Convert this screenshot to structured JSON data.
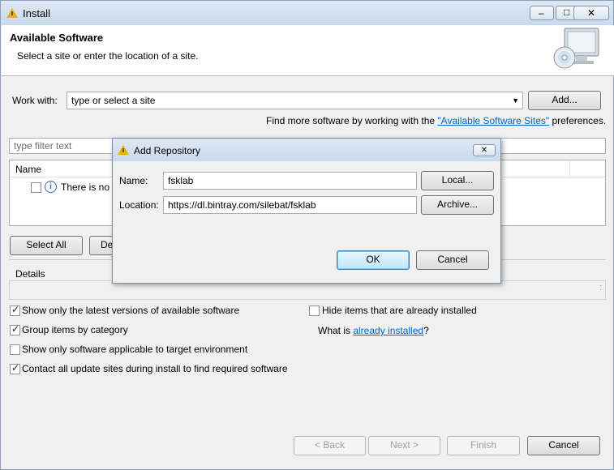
{
  "window": {
    "title": "Install",
    "minimize_glyph": "–",
    "maximize_glyph": "□",
    "close_glyph": "✕"
  },
  "banner": {
    "title": "Available Software",
    "subtitle": "Select a site or enter the location of a site."
  },
  "work_with": {
    "label": "Work with:",
    "value": "type or select a site",
    "add_label": "Add...",
    "find_more_prefix": "Find more software by working with the ",
    "find_more_link": "\"Available Software Sites\"",
    "find_more_suffix": " preferences."
  },
  "filter": {
    "placeholder": "type filter text"
  },
  "tree": {
    "column_name": "Name",
    "row_text": "There is no s"
  },
  "buttons": {
    "select_all": "Select All",
    "deselect_all": "De"
  },
  "details": {
    "label": "Details"
  },
  "options": {
    "show_latest": "Show only the latest versions of available software",
    "group_by_category": "Group items by category",
    "show_applicable": "Show only software applicable to target environment",
    "contact_all": "Contact all update sites during install to find required software",
    "hide_installed": "Hide items that are already installed",
    "what_is_prefix": "What is ",
    "what_is_link": "already installed",
    "what_is_suffix": "?"
  },
  "footer": {
    "back": "< Back",
    "next": "Next >",
    "finish": "Finish",
    "cancel": "Cancel"
  },
  "dialog": {
    "title": "Add Repository",
    "close_glyph": "✕",
    "name_label": "Name:",
    "name_value": "fsklab",
    "local_button": "Local...",
    "location_label": "Location:",
    "location_value": "https://dl.bintray.com/silebat/fsklab",
    "archive_button": "Archive...",
    "ok_button": "OK",
    "cancel_button": "Cancel"
  }
}
